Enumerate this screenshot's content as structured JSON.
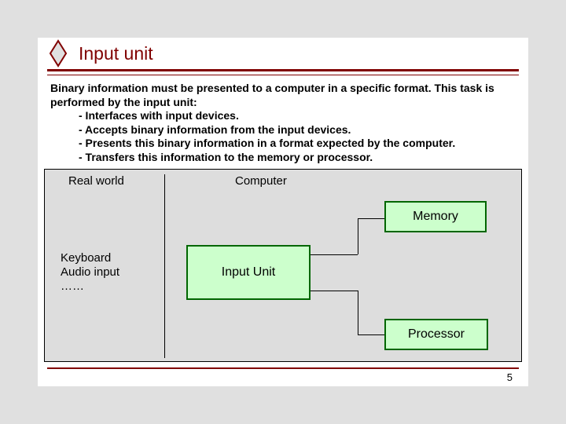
{
  "title": "Input unit",
  "intro": "Binary information must be presented to a computer in a specific format. This task is performed by the input unit:",
  "bullets": [
    "- Interfaces with input devices.",
    "- Accepts binary information from the input devices.",
    "- Presents this binary information in a format expected by the computer.",
    "- Transfers this information to the memory or processor."
  ],
  "diagram": {
    "real_label": "Real world",
    "computer_label": "Computer",
    "realworld_text": "Keyboard\nAudio input\n……",
    "input_unit": "Input Unit",
    "memory": "Memory",
    "processor": "Processor"
  },
  "page_number": "5",
  "colors": {
    "accent": "#800000",
    "box_fill": "#ccffcc",
    "box_border": "#006600"
  }
}
